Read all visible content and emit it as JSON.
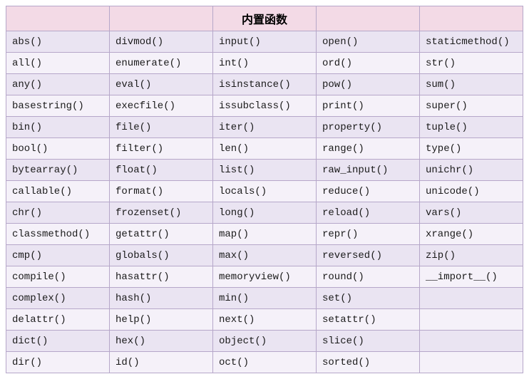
{
  "header": {
    "title": "内置函数",
    "blank": ""
  },
  "rows": [
    [
      "abs()",
      "divmod()",
      "input()",
      "open()",
      "staticmethod()"
    ],
    [
      "all()",
      "enumerate()",
      "int()",
      "ord()",
      "str()"
    ],
    [
      "any()",
      "eval()",
      "isinstance()",
      "pow()",
      "sum()"
    ],
    [
      "basestring()",
      "execfile()",
      "issubclass()",
      "print()",
      "super()"
    ],
    [
      "bin()",
      "file()",
      "iter()",
      "property()",
      "tuple()"
    ],
    [
      "bool()",
      "filter()",
      "len()",
      "range()",
      "type()"
    ],
    [
      "bytearray()",
      "float()",
      "list()",
      "raw_input()",
      "unichr()"
    ],
    [
      "callable()",
      "format()",
      "locals()",
      "reduce()",
      "unicode()"
    ],
    [
      "chr()",
      "frozenset()",
      "long()",
      "reload()",
      "vars()"
    ],
    [
      "classmethod()",
      "getattr()",
      "map()",
      "repr()",
      "xrange()"
    ],
    [
      "cmp()",
      "globals()",
      "max()",
      "reversed()",
      "zip()"
    ],
    [
      "compile()",
      "hasattr()",
      "memoryview()",
      "round()",
      "__import__()"
    ],
    [
      "complex()",
      "hash()",
      "min()",
      "set()",
      ""
    ],
    [
      "delattr()",
      "help()",
      "next()",
      "setattr()",
      ""
    ],
    [
      "dict()",
      "hex()",
      "object()",
      "slice()",
      ""
    ],
    [
      "dir()",
      "id()",
      "oct()",
      "sorted()",
      ""
    ]
  ]
}
